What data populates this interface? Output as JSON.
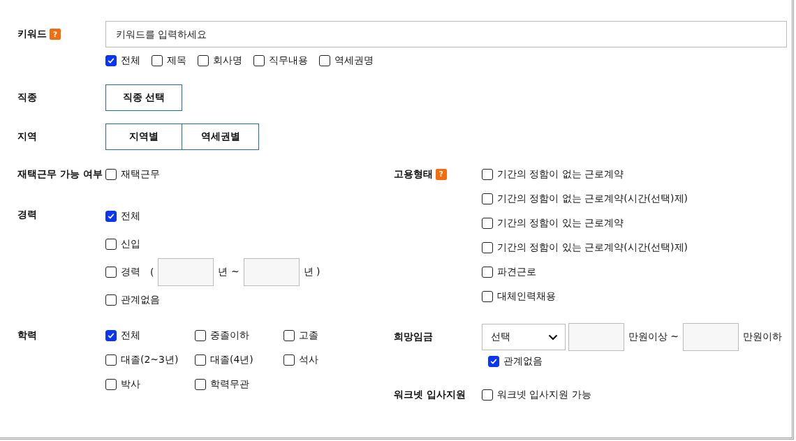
{
  "keyword": {
    "label": "키워드",
    "help": "?",
    "placeholder": "키워드를 입력하세요",
    "scopes": [
      {
        "label": "전체",
        "checked": true
      },
      {
        "label": "제목",
        "checked": false
      },
      {
        "label": "회사명",
        "checked": false
      },
      {
        "label": "직무내용",
        "checked": false
      },
      {
        "label": "역세권명",
        "checked": false
      }
    ]
  },
  "job_type": {
    "label": "직종",
    "button": "직종 선택"
  },
  "region": {
    "label": "지역",
    "buttons": [
      "지역별",
      "역세권별"
    ]
  },
  "remote": {
    "label": "재택근무 가능 여부",
    "options": [
      {
        "label": "재택근무",
        "checked": false
      }
    ]
  },
  "experience": {
    "label": "경력",
    "options": [
      {
        "kind": "plain",
        "label": "전체",
        "checked": true
      },
      {
        "kind": "plain",
        "label": "신입",
        "checked": false
      },
      {
        "kind": "range",
        "label": "경력",
        "checked": false,
        "open": "(",
        "from_unit": "년 ~",
        "to_unit": "년 )"
      },
      {
        "kind": "plain",
        "label": "관계없음",
        "checked": false
      }
    ]
  },
  "education": {
    "label": "학력",
    "options": [
      {
        "label": "전체",
        "checked": true
      },
      {
        "label": "중졸이하",
        "checked": false
      },
      {
        "label": "고졸",
        "checked": false
      },
      {
        "label": "대졸(2~3년)",
        "checked": false
      },
      {
        "label": "대졸(4년)",
        "checked": false
      },
      {
        "label": "석사",
        "checked": false
      },
      {
        "label": "박사",
        "checked": false
      },
      {
        "label": "학력무관",
        "checked": false
      }
    ]
  },
  "employment_type": {
    "label": "고용형태",
    "help": "?",
    "options": [
      {
        "label": "기간의 정함이 없는 근로계약",
        "checked": false
      },
      {
        "label": "기간의 정함이 없는 근로계약(시간(선택)제)",
        "checked": false
      },
      {
        "label": "기간의 정함이 있는 근로계약",
        "checked": false
      },
      {
        "label": "기간의 정함이 있는 근로계약(시간(선택)제)",
        "checked": false
      },
      {
        "label": "파견근로",
        "checked": false
      },
      {
        "label": "대체인력채용",
        "checked": false
      }
    ]
  },
  "salary": {
    "label": "희망임금",
    "select": "선택",
    "from_unit": "만원이상 ~",
    "to_unit": "만원이하",
    "any": {
      "label": "관계없음",
      "checked": true
    }
  },
  "worknet": {
    "label": "워크넷 입사지원",
    "options": [
      {
        "label": "워크넷 입사지원 가능",
        "checked": false
      }
    ]
  }
}
